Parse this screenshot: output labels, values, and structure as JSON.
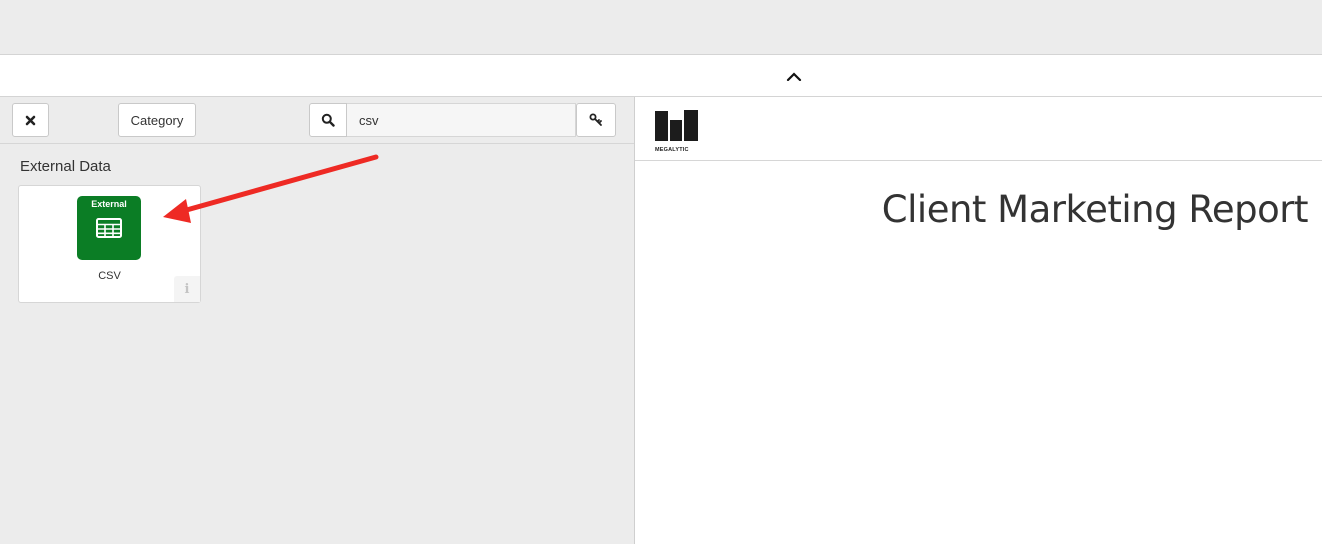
{
  "collapse": {
    "icon": "chevron-up-icon"
  },
  "toolbar": {
    "close_icon": "close-icon",
    "category_label": "Category",
    "search_icon": "search-icon",
    "search_value": "csv",
    "key_icon": "key-icon"
  },
  "section": {
    "title": "External Data",
    "items": [
      {
        "badge": "External",
        "icon": "table-icon",
        "label": "CSV",
        "info_icon": "info-icon",
        "color": "#0b7d25"
      }
    ]
  },
  "annotation": {
    "icon": "arrow-icon",
    "color": "#ee2a24"
  },
  "report": {
    "logo_text": "MEGALYTIC",
    "title": "Client Marketing Report"
  }
}
